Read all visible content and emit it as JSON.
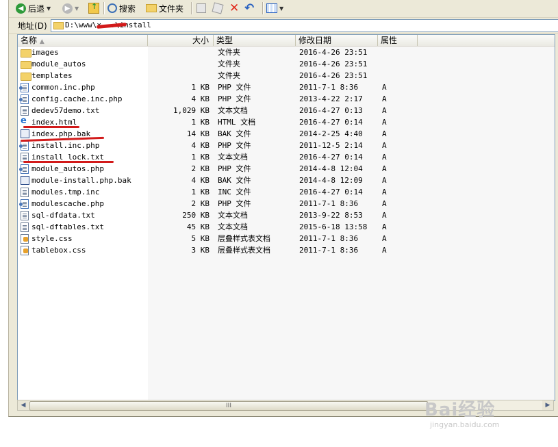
{
  "toolbar": {
    "back_label": "后退",
    "search_label": "搜索",
    "folders_label": "文件夹"
  },
  "address": {
    "label": "地址",
    "label_key": "(D)",
    "path": "D:\\www\\x...\\install"
  },
  "columns": [
    "名称",
    "大小",
    "类型",
    "修改日期",
    "属性"
  ],
  "files": [
    {
      "name": "images",
      "size": "",
      "type": "文件夹",
      "date": "2016-4-26 23:51",
      "attr": "",
      "icon": "folder-icon"
    },
    {
      "name": "module_autos",
      "size": "",
      "type": "文件夹",
      "date": "2016-4-26 23:51",
      "attr": "",
      "icon": "folder-icon"
    },
    {
      "name": "templates",
      "size": "",
      "type": "文件夹",
      "date": "2016-4-26 23:51",
      "attr": "",
      "icon": "folder-icon"
    },
    {
      "name": "common.inc.php",
      "size": "1 KB",
      "type": "PHP 文件",
      "date": "2011-7-1 8:36",
      "attr": "A",
      "icon": "php-file-icon"
    },
    {
      "name": "config.cache.inc.php",
      "size": "4 KB",
      "type": "PHP 文件",
      "date": "2013-4-22 2:17",
      "attr": "A",
      "icon": "php-file-icon"
    },
    {
      "name": "dedev57demo.txt",
      "size": "1,029 KB",
      "type": "文本文档",
      "date": "2016-4-27 0:13",
      "attr": "A",
      "icon": "text-file-icon"
    },
    {
      "name": "index.html",
      "size": "1 KB",
      "type": "HTML 文档",
      "date": "2016-4-27 0:14",
      "attr": "A",
      "icon": "html-file-icon"
    },
    {
      "name": "index.php.bak",
      "size": "14 KB",
      "type": "BAK 文件",
      "date": "2014-2-25 4:40",
      "attr": "A",
      "icon": "bak-file-icon"
    },
    {
      "name": "install.inc.php",
      "size": "4 KB",
      "type": "PHP 文件",
      "date": "2011-12-5 2:14",
      "attr": "A",
      "icon": "php-file-icon"
    },
    {
      "name": "install_lock.txt",
      "size": "1 KB",
      "type": "文本文档",
      "date": "2016-4-27 0:14",
      "attr": "A",
      "icon": "text-file-icon"
    },
    {
      "name": "module_autos.php",
      "size": "2 KB",
      "type": "PHP 文件",
      "date": "2014-4-8 12:04",
      "attr": "A",
      "icon": "php-file-icon"
    },
    {
      "name": "module-install.php.bak",
      "size": "4 KB",
      "type": "BAK 文件",
      "date": "2014-4-8 12:09",
      "attr": "A",
      "icon": "bak-file-icon"
    },
    {
      "name": "modules.tmp.inc",
      "size": "1 KB",
      "type": "INC 文件",
      "date": "2016-4-27 0:14",
      "attr": "A",
      "icon": "inc-file-icon"
    },
    {
      "name": "modulescache.php",
      "size": "2 KB",
      "type": "PHP 文件",
      "date": "2011-7-1 8:36",
      "attr": "A",
      "icon": "php-file-icon"
    },
    {
      "name": "sql-dfdata.txt",
      "size": "250 KB",
      "type": "文本文档",
      "date": "2013-9-22 8:53",
      "attr": "A",
      "icon": "text-file-icon"
    },
    {
      "name": "sql-dftables.txt",
      "size": "45 KB",
      "type": "文本文档",
      "date": "2015-6-18 13:58",
      "attr": "A",
      "icon": "text-file-icon"
    },
    {
      "name": "style.css",
      "size": "5 KB",
      "type": "层叠样式表文档",
      "date": "2011-7-1 8:36",
      "attr": "A",
      "icon": "css-file-icon"
    },
    {
      "name": "tablebox.css",
      "size": "3 KB",
      "type": "层叠样式表文档",
      "date": "2011-7-1 8:36",
      "attr": "A",
      "icon": "css-file-icon"
    }
  ],
  "scrollbar": {
    "thumb_grip": "III"
  },
  "watermark": {
    "brand": "Bai经验",
    "url": "jingyan.baidu.com"
  },
  "colors": {
    "annotation": "#d21a1a",
    "window_bg": "#ece9d8"
  }
}
